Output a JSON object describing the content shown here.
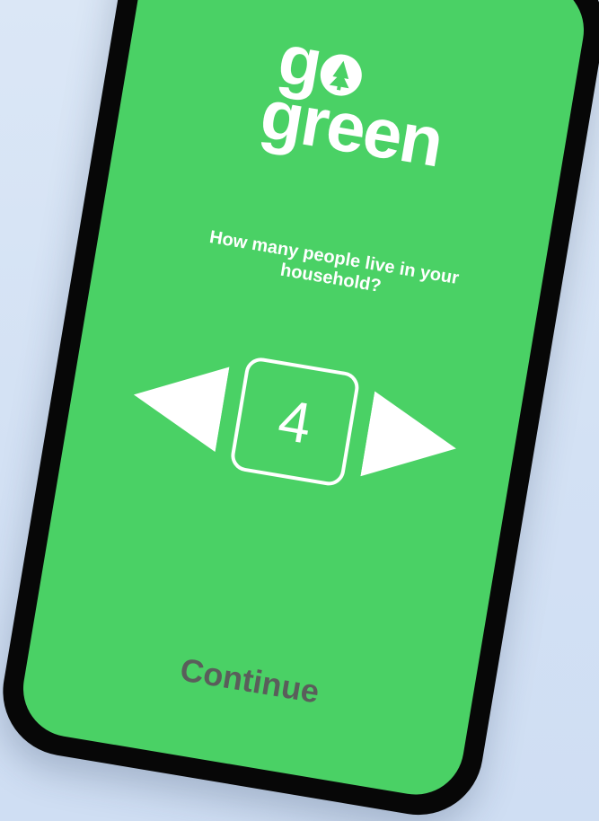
{
  "app": {
    "logo_line1": "g",
    "logo_line2": "green",
    "logo_o_icon": "tree-in-circle"
  },
  "question": {
    "text": "How many people live in your household?"
  },
  "stepper": {
    "value": "4",
    "decrement_icon": "triangle-left",
    "increment_icon": "triangle-right"
  },
  "footer": {
    "continue_label": "Continue"
  },
  "colors": {
    "background": "#d6e4f5",
    "screen": "#4ad165",
    "frame": "#070707",
    "foreground": "#ffffff",
    "continue_text": "#5a5e5b"
  }
}
